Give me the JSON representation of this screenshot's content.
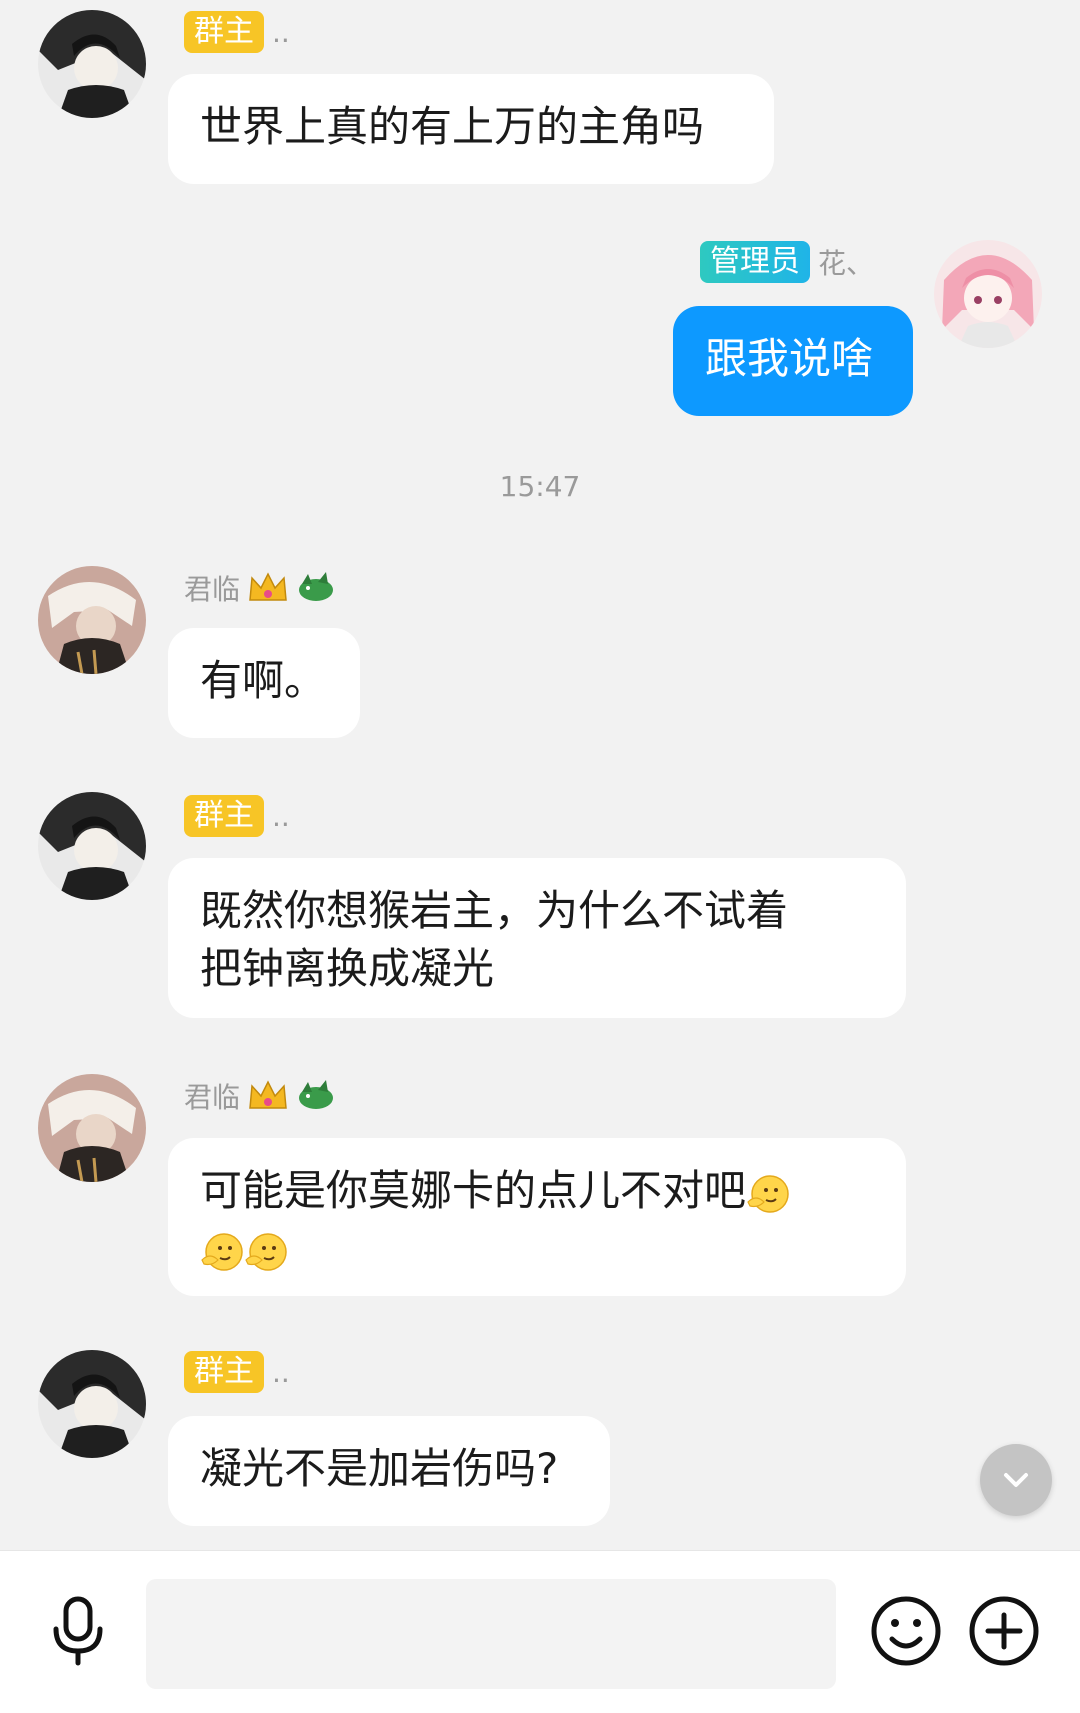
{
  "messages": [
    {
      "sender_badge": "群主",
      "sender_name": "..",
      "text": "世界上真的有上万的主角吗"
    },
    {
      "sender_badge": "管理员",
      "sender_name": "花、",
      "text": "跟我说啥"
    },
    {
      "sender_name": "君临",
      "text": "有啊。"
    },
    {
      "sender_badge": "群主",
      "sender_name": "..",
      "text_line1": "既然你想猴岩主，为什么不试着",
      "text_line2": "把钟离换成凝光"
    },
    {
      "sender_name": "君临",
      "text_line1": "可能是你莫娜卡的点儿不对吧"
    },
    {
      "sender_badge": "群主",
      "sender_name": "..",
      "text": "凝光不是加岩伤吗?"
    }
  ],
  "timestamp": "15:47",
  "colors": {
    "background": "#f2f2f2",
    "bubble_other": "#ffffff",
    "bubble_self": "#0d99ff",
    "owner_badge": "#f7c526",
    "admin_badge": "#1fb4e8"
  },
  "icons": {
    "voice": "microphone-icon",
    "emoji": "smiley-icon",
    "more": "plus-icon",
    "scroll": "chevron-down-icon"
  }
}
